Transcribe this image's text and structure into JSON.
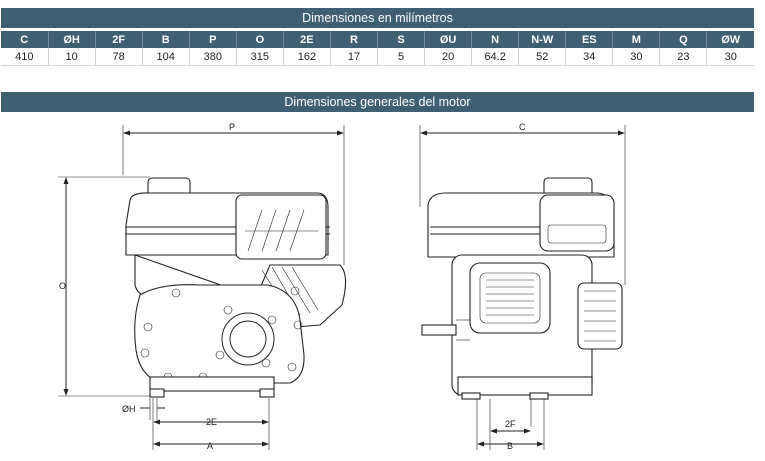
{
  "table": {
    "title": "Dimensiones en milímetros",
    "headers": [
      "C",
      "ØH",
      "2F",
      "B",
      "P",
      "O",
      "2E",
      "R",
      "S",
      "ØU",
      "N",
      "N-W",
      "ES",
      "M",
      "Q",
      "ØW"
    ],
    "values": [
      "410",
      "10",
      "78",
      "104",
      "380",
      "315",
      "162",
      "17",
      "5",
      "20",
      "64.2",
      "52",
      "34",
      "30",
      "23",
      "30"
    ]
  },
  "drawing": {
    "title": "Dimensiones generales del motor",
    "labels": {
      "P": "P",
      "O": "O",
      "H": "ØH",
      "E2": "2E",
      "A": "A",
      "C": "C",
      "F2": "2F",
      "B": "B"
    }
  }
}
